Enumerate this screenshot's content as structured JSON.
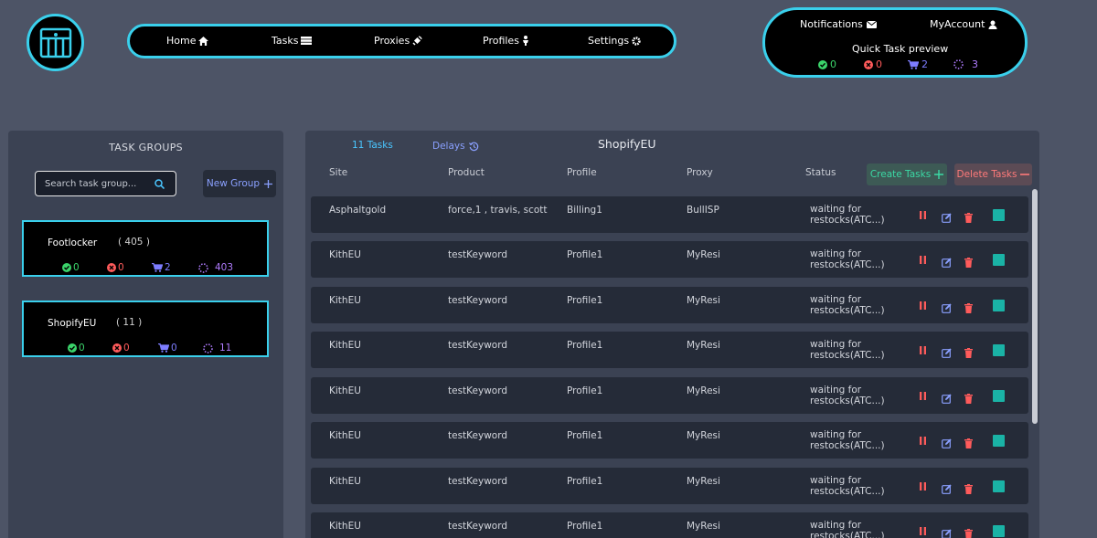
{
  "header": {
    "nav": [
      {
        "label": "Home",
        "icon": "home-icon"
      },
      {
        "label": "Tasks",
        "icon": "tasks-icon"
      },
      {
        "label": "Proxies",
        "icon": "satellite-icon"
      },
      {
        "label": "Profiles",
        "icon": "person-icon"
      },
      {
        "label": "Settings",
        "icon": "gear-icon"
      }
    ],
    "account": {
      "notifications_label": "Notifications",
      "myaccount_label": "MyAccount",
      "preview_title": "Quick Task preview",
      "stats": {
        "success": "0",
        "failed": "0",
        "cart": "2",
        "waiting": "3"
      }
    }
  },
  "task_groups": {
    "title": "TASK GROUPS",
    "search_placeholder": "Search task group...",
    "new_group_label": "New Group",
    "groups": [
      {
        "name": "Footlocker",
        "count": "( 405 )",
        "success": "0",
        "failed": "0",
        "cart": "2",
        "waiting": "403"
      },
      {
        "name": "ShopifyEU",
        "count": "( 11 )",
        "success": "0",
        "failed": "0",
        "cart": "0",
        "waiting": "11"
      }
    ]
  },
  "main": {
    "tabs": {
      "tasks": "11 Tasks",
      "delays": "Delays"
    },
    "title": "ShopifyEU",
    "columns": {
      "site": "Site",
      "product": "Product",
      "profile": "Profile",
      "proxy": "Proxy",
      "status": "Status"
    },
    "create_label": "Create Tasks",
    "delete_label": "Delete Tasks",
    "tasks": [
      {
        "site": "Asphaltgold",
        "product": "force,1 , travis, scott",
        "profile": "Billing1",
        "proxy": "BullISP",
        "status": "waiting for restocks(ATC...)"
      },
      {
        "site": "KithEU",
        "product": "testKeyword",
        "profile": "Profile1",
        "proxy": "MyResi",
        "status": "waiting for restocks(ATC...)"
      },
      {
        "site": "KithEU",
        "product": "testKeyword",
        "profile": "Profile1",
        "proxy": "MyResi",
        "status": "waiting for restocks(ATC...)"
      },
      {
        "site": "KithEU",
        "product": "testKeyword",
        "profile": "Profile1",
        "proxy": "MyResi",
        "status": "waiting for restocks(ATC...)"
      },
      {
        "site": "KithEU",
        "product": "testKeyword",
        "profile": "Profile1",
        "proxy": "MyResi",
        "status": "waiting for restocks(ATC...)"
      },
      {
        "site": "KithEU",
        "product": "testKeyword",
        "profile": "Profile1",
        "proxy": "MyResi",
        "status": "waiting for restocks(ATC...)"
      },
      {
        "site": "KithEU",
        "product": "testKeyword",
        "profile": "Profile1",
        "proxy": "MyResi",
        "status": "waiting for restocks(ATC...)"
      },
      {
        "site": "KithEU",
        "product": "testKeyword",
        "profile": "Profile1",
        "proxy": "MyResi",
        "status": "waiting for restocks(ATC...)"
      }
    ]
  },
  "colors": {
    "accent": "#3ad0ec",
    "success": "#3bd36a",
    "failed": "#ff5b5b",
    "cart": "#7d7dff",
    "waiting": "#b07cff",
    "teal": "#1ab3a6"
  }
}
